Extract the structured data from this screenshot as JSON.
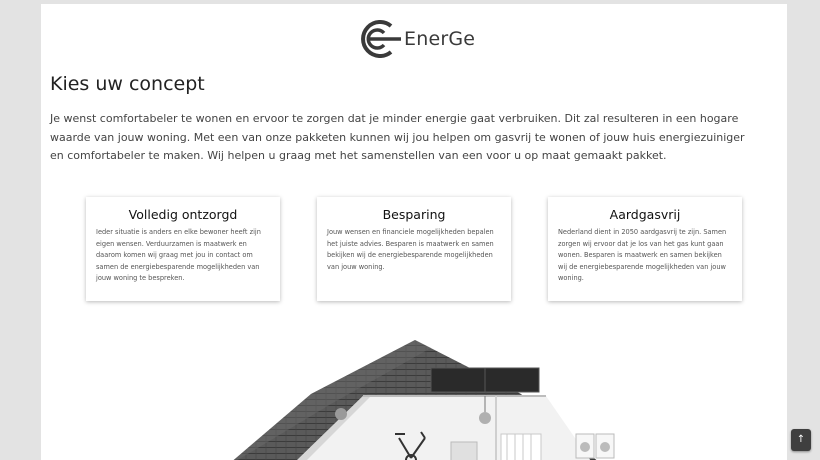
{
  "header": {
    "logo_text": "EnerGe",
    "logo_icon": "energe-logo-icon"
  },
  "main": {
    "title": "Kies uw concept",
    "intro": "Je wenst comfortabeler te wonen en ervoor te zorgen dat je minder energie gaat verbruiken. Dit zal resulteren in een hogare waarde van jouw woning. Met een van onze pakketen kunnen wij jou helpen om gasvrij te wonen of jouw huis energiezuiniger en comfortabeler te maken. Wij helpen u graag met het samenstellen van een voor u op maat gemaakt pakket.",
    "cards": [
      {
        "title": "Volledig ontzorgd",
        "text": "Ieder situatie is anders en elke bewoner heeft zijn eigen wensen. Verduurzamen is maatwerk en daarom komen wij graag met jou in contact om samen de energiebesparende mogelijkheden van jouw woning te bespreken."
      },
      {
        "title": "Besparing",
        "text": "Jouw wensen en financiele mogelijkheden bepalen het juiste advies. Besparen is maatwerk en samen bekijken wij de energiebesparende mogelijkheden van jouw woning."
      },
      {
        "title": "Aardgasvrij",
        "text": "Nederland dient in 2050 aardgasvrij te zijn. Samen zorgen wij ervoor dat je los van het gas kunt gaan wonen. Besparen is maatwerk en samen bekijken wij de energiebesparende mogelijkheden van jouw woning."
      }
    ]
  },
  "scroll_top": {
    "icon": "arrow-up-icon",
    "glyph": "↑"
  }
}
